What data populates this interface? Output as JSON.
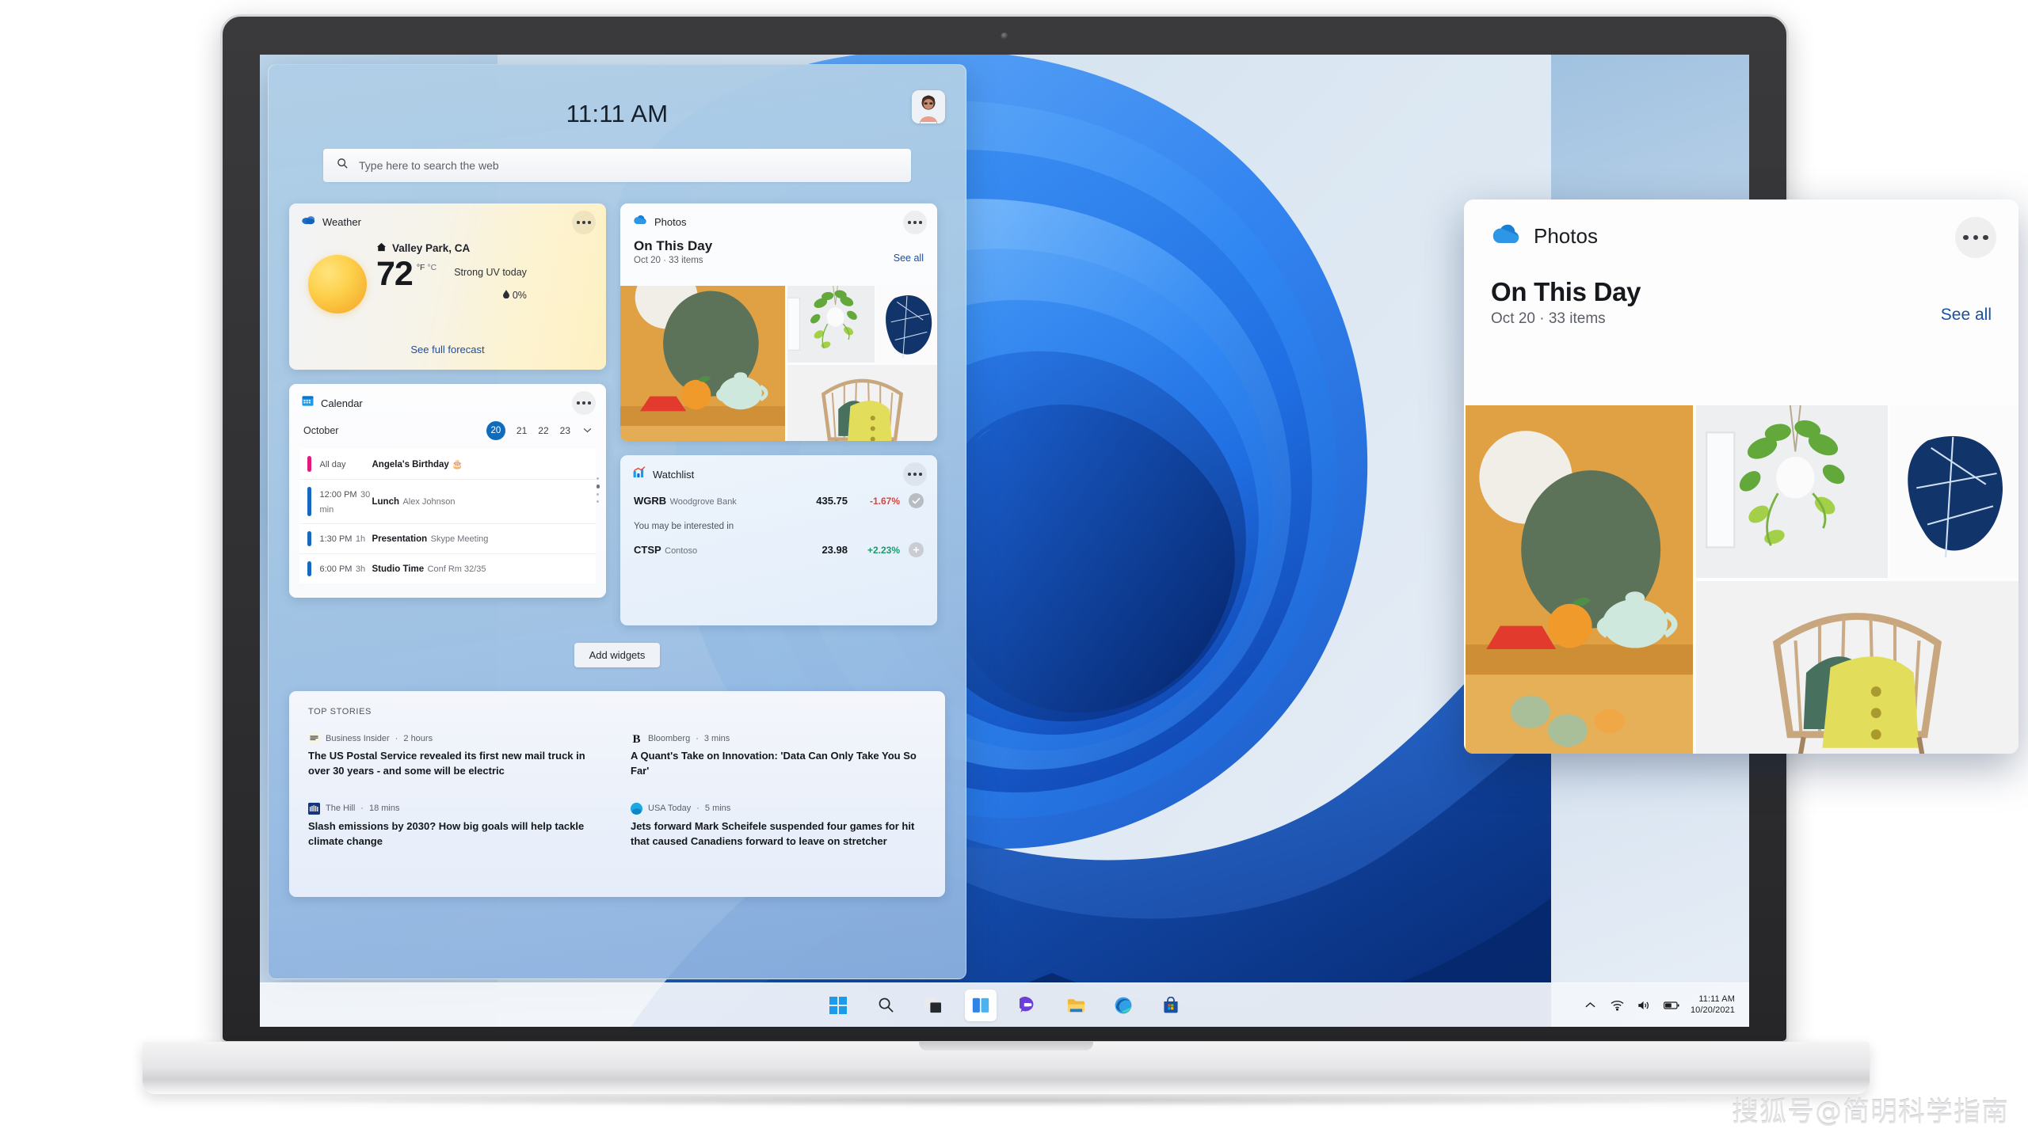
{
  "desktop": {
    "wallpaper_name": "windows-11-bloom",
    "colors": {
      "accent": "#0f6cbd",
      "panel_bg": "#a6c7e4",
      "bloom_blue": "#1b6ef0",
      "bloom_dark": "#0b3f9e"
    }
  },
  "widgets_panel": {
    "clock": "11:11 AM",
    "avatar_name": "user-avatar",
    "search": {
      "placeholder": "Type here to search the web",
      "icon": "search-icon"
    },
    "add_widgets_label": "Add widgets",
    "weather": {
      "app_name": "Weather",
      "icon": "weather-cloud-icon",
      "location": "Valley Park, CA",
      "location_icon": "home-icon",
      "temperature": "72",
      "unit_f": "°F",
      "unit_c": "°C",
      "uv_text": "Strong UV today",
      "precip_icon": "water-drop-icon",
      "precipitation": "0%",
      "forecast_link": "See full forecast",
      "more_icon": "more-dots-icon"
    },
    "calendar": {
      "app_name": "Calendar",
      "icon": "calendar-icon",
      "month": "October",
      "days": [
        "20",
        "21",
        "22",
        "23"
      ],
      "selected_day": "20",
      "expand_icon": "chevron-down-icon",
      "more_icon": "more-dots-icon",
      "events": [
        {
          "time": "All day",
          "duration": "",
          "title": "Angela's Birthday 🎂",
          "subtitle": "",
          "color": "#e3187c"
        },
        {
          "time": "12:00 PM",
          "duration": "30 min",
          "title": "Lunch",
          "subtitle": "Alex Johnson",
          "color": "#1668c1"
        },
        {
          "time": "1:30 PM",
          "duration": "1h",
          "title": "Presentation",
          "subtitle": "Skype Meeting",
          "color": "#1668c1"
        },
        {
          "time": "6:00 PM",
          "duration": "3h",
          "title": "Studio Time",
          "subtitle": "Conf Rm 32/35",
          "color": "#1668c1"
        }
      ]
    },
    "photos": {
      "app_name": "Photos",
      "icon": "onedrive-cloud-icon",
      "title": "On This Day",
      "subtitle": "Oct 20 · 33 items",
      "see_all": "See all",
      "more_icon": "more-dots-icon",
      "images": [
        "still-life-teapot",
        "hanging-plant",
        "abstract-blue-art",
        "rattan-chair-yellow-pillow"
      ]
    },
    "watchlist": {
      "app_name": "Watchlist",
      "icon": "stocks-chart-icon",
      "more_icon": "more-dots-icon",
      "note": "You may be interested in",
      "stocks": [
        {
          "symbol": "WGRB",
          "name": "Woodgrove Bank",
          "price": "435.75",
          "change": "-1.67%",
          "change_color": "#d6453d",
          "action_icon": "check-icon",
          "action_bg": "#b8bcc3"
        },
        {
          "symbol": "CTSP",
          "name": "Contoso",
          "price": "23.98",
          "change": "+2.23%",
          "change_color": "#1a9a6c",
          "action_icon": "plus-icon",
          "action_bg": "#c9ccd2"
        }
      ]
    },
    "news": {
      "section_label": "TOP STORIES",
      "items": [
        {
          "source": "Business Insider",
          "time": "2 hours",
          "favicon": "business-insider-icon",
          "headline": "The US Postal Service revealed its first new mail truck in over 30 years - and some will be electric"
        },
        {
          "source": "Bloomberg",
          "time": "3 mins",
          "favicon": "bloomberg-b-icon",
          "headline": "A Quant's Take on Innovation: 'Data Can Only Take You So Far'"
        },
        {
          "source": "The Hill",
          "time": "18 mins",
          "favicon": "the-hill-icon",
          "headline": "Slash emissions by 2030? How big goals will help tackle climate change"
        },
        {
          "source": "USA Today",
          "time": "5 mins",
          "favicon": "usa-today-icon",
          "headline": "Jets forward Mark Scheifele suspended four games for hit that caused Canadiens forward to leave on stretcher"
        }
      ]
    }
  },
  "callout": {
    "app_name": "Photos",
    "icon": "onedrive-cloud-icon",
    "more_icon": "more-dots-icon",
    "title": "On This Day",
    "subtitle": "Oct 20 · 33 items",
    "see_all": "See all"
  },
  "taskbar": {
    "buttons": [
      {
        "name": "start-button",
        "icon": "windows-logo-icon",
        "active": false
      },
      {
        "name": "search-button",
        "icon": "search-icon",
        "active": false
      },
      {
        "name": "task-view-button",
        "icon": "task-view-icon",
        "active": false
      },
      {
        "name": "widgets-button",
        "icon": "widgets-icon",
        "active": true
      },
      {
        "name": "chat-button",
        "icon": "chat-icon",
        "active": false
      },
      {
        "name": "file-explorer-button",
        "icon": "folder-icon",
        "active": false
      },
      {
        "name": "edge-button",
        "icon": "edge-icon",
        "active": false
      },
      {
        "name": "microsoft-store-button",
        "icon": "store-bag-icon",
        "active": false
      }
    ],
    "tray": {
      "overflow_icon": "chevron-up-icon",
      "network_icon": "wifi-icon",
      "volume_icon": "speaker-icon",
      "battery_icon": "battery-icon",
      "time": "11:11 AM",
      "date": "10/20/2021"
    }
  },
  "watermark": {
    "text": "搜狐号@简明科学指南"
  }
}
